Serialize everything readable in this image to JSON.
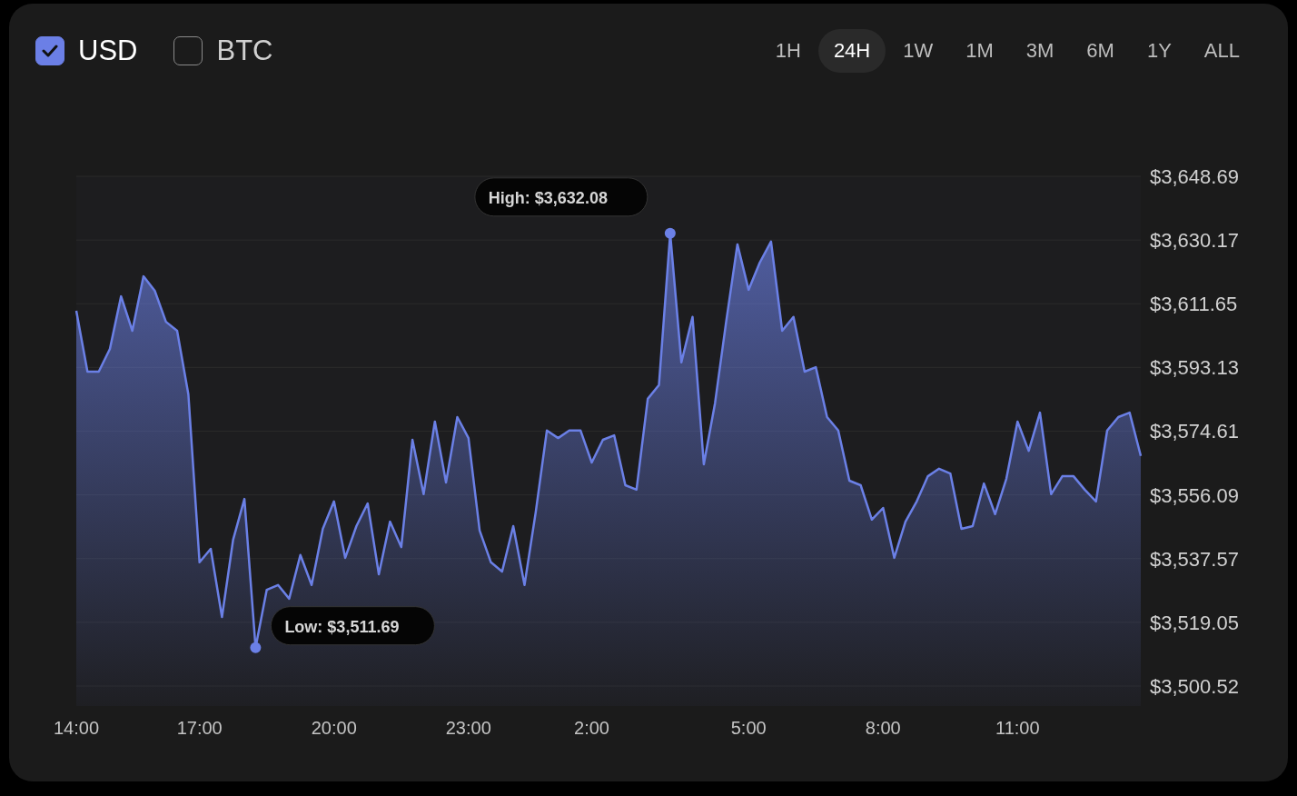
{
  "currencies": [
    {
      "label": "USD",
      "checked": true
    },
    {
      "label": "BTC",
      "checked": false
    }
  ],
  "ranges": [
    {
      "label": "1H",
      "selected": false
    },
    {
      "label": "24H",
      "selected": true
    },
    {
      "label": "1W",
      "selected": false
    },
    {
      "label": "1M",
      "selected": false
    },
    {
      "label": "3M",
      "selected": false
    },
    {
      "label": "6M",
      "selected": false
    },
    {
      "label": "1Y",
      "selected": false
    },
    {
      "label": "ALL",
      "selected": false
    }
  ],
  "chart": {
    "chart_data": {
      "type": "area",
      "categories": [
        "14:00",
        null,
        null,
        null,
        null,
        null,
        null,
        null,
        null,
        null,
        null,
        "17:00",
        null,
        null,
        null,
        null,
        null,
        null,
        null,
        null,
        null,
        null,
        null,
        "20:00",
        null,
        null,
        null,
        null,
        null,
        null,
        null,
        null,
        null,
        null,
        null,
        "23:00",
        null,
        null,
        null,
        null,
        null,
        null,
        null,
        null,
        null,
        null,
        "2:00",
        null,
        null,
        null,
        null,
        null,
        null,
        null,
        null,
        null,
        null,
        null,
        null,
        null,
        "5:00",
        null,
        null,
        null,
        null,
        null,
        null,
        null,
        null,
        null,
        null,
        null,
        "8:00",
        null,
        null,
        null,
        null,
        null,
        null,
        null,
        null,
        null,
        null,
        null,
        "11:00",
        null,
        null,
        null,
        null,
        null,
        null,
        null,
        null,
        null,
        null,
        null
      ],
      "series": [
        {
          "color": "#6b80e6",
          "values": [
            3609.6,
            3591.9,
            3591.9,
            3598.5,
            3613.8,
            3603.8,
            3619.6,
            3615.4,
            3606.4,
            3603.8,
            3585.3,
            3536.5,
            3540.4,
            3520.6,
            3543.1,
            3554.9,
            3511.7,
            3528.5,
            3529.9,
            3525.9,
            3538.6,
            3529.9,
            3546.2,
            3554.2,
            3537.8,
            3547.0,
            3553.6,
            3533.0,
            3548.3,
            3540.9,
            3572.1,
            3556.3,
            3577.4,
            3559.7,
            3578.7,
            3572.6,
            3545.7,
            3536.5,
            3533.8,
            3547.0,
            3529.9,
            3551.0,
            3574.8,
            3572.6,
            3574.8,
            3574.8,
            3565.5,
            3572.1,
            3573.4,
            3558.9,
            3557.6,
            3584.0,
            3588.0,
            3632.1,
            3594.6,
            3607.8,
            3565.0,
            3582.7,
            3606.4,
            3628.9,
            3615.7,
            3623.6,
            3629.7,
            3603.8,
            3607.8,
            3591.9,
            3593.2,
            3578.7,
            3574.8,
            3560.2,
            3558.9,
            3548.9,
            3552.3,
            3537.8,
            3548.3,
            3554.2,
            3561.5,
            3563.7,
            3562.3,
            3546.2,
            3547.0,
            3559.4,
            3550.5,
            3560.8,
            3577.4,
            3568.9,
            3580.0,
            3556.3,
            3561.5,
            3561.5,
            3557.6,
            3554.2,
            3574.8,
            3578.7,
            3580.0,
            3567.4
          ]
        }
      ],
      "ylim": [
        3500.52,
        3648.69
      ],
      "grid": true,
      "yticks": [
        {
          "value": 3648.69,
          "label": "$3,648.69"
        },
        {
          "value": 3630.17,
          "label": "$3,630.17"
        },
        {
          "value": 3611.65,
          "label": "$3,611.65"
        },
        {
          "value": 3593.13,
          "label": "$3,593.13"
        },
        {
          "value": 3574.61,
          "label": "$3,574.61"
        },
        {
          "value": 3556.09,
          "label": "$3,556.09"
        },
        {
          "value": 3537.57,
          "label": "$3,537.57"
        },
        {
          "value": 3519.05,
          "label": "$3,519.05"
        },
        {
          "value": 3500.52,
          "label": "$3,500.52"
        }
      ],
      "annotations": [
        "High: $3,632.08",
        "Low: $3,511.69"
      ]
    }
  }
}
